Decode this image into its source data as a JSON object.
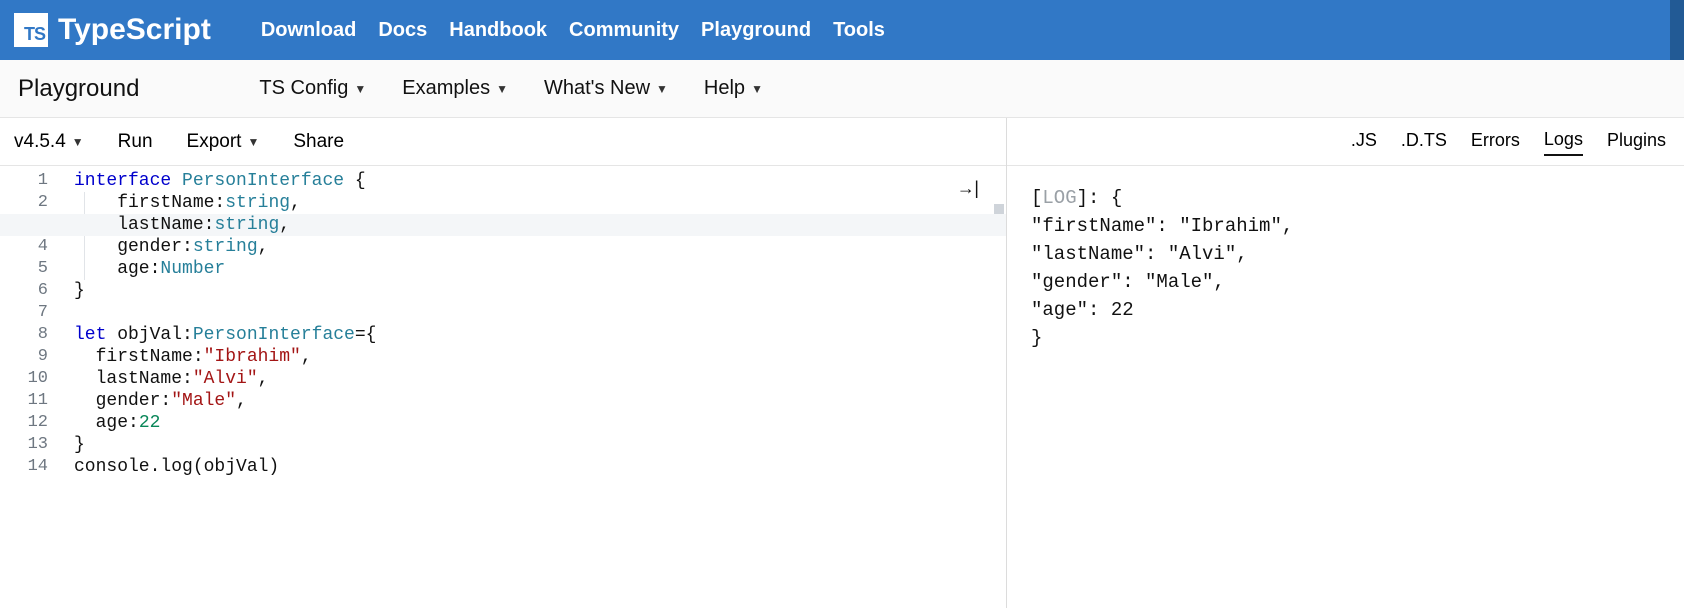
{
  "brand": {
    "logo": "TS",
    "name": "TypeScript"
  },
  "topnav": [
    "Download",
    "Docs",
    "Handbook",
    "Community",
    "Playground",
    "Tools"
  ],
  "subnav": {
    "title": "Playground",
    "items": [
      "TS Config",
      "Examples",
      "What's New",
      "Help"
    ]
  },
  "toolbar": {
    "version": "v4.5.4",
    "buttons": [
      "Run",
      "Export",
      "Share"
    ],
    "run_glyph": "→|",
    "right_tabs": [
      ".JS",
      ".D.TS",
      "Errors",
      "Logs",
      "Plugins"
    ],
    "active_right_tab": "Logs"
  },
  "editor": {
    "highlight_line": 3,
    "lines": [
      [
        [
          "kw",
          "interface"
        ],
        [
          "pln",
          " "
        ],
        [
          "id",
          "PersonInterface"
        ],
        [
          "pln",
          " {"
        ]
      ],
      [
        [
          "pln",
          "    firstName:"
        ],
        [
          "type",
          "string"
        ],
        [
          "pln",
          ","
        ]
      ],
      [
        [
          "pln",
          "    lastName:"
        ],
        [
          "type",
          "string"
        ],
        [
          "pln",
          ","
        ]
      ],
      [
        [
          "pln",
          "    gender:"
        ],
        [
          "type",
          "string"
        ],
        [
          "pln",
          ","
        ]
      ],
      [
        [
          "pln",
          "    age:"
        ],
        [
          "type",
          "Number"
        ]
      ],
      [
        [
          "pln",
          "}"
        ]
      ],
      [
        [
          "pln",
          ""
        ]
      ],
      [
        [
          "kw",
          "let"
        ],
        [
          "pln",
          " objVal:"
        ],
        [
          "id",
          "PersonInterface"
        ],
        [
          "pln",
          "={"
        ]
      ],
      [
        [
          "pln",
          "  firstName:"
        ],
        [
          "str",
          "\"Ibrahim\""
        ],
        [
          "pln",
          ","
        ]
      ],
      [
        [
          "pln",
          "  lastName:"
        ],
        [
          "str",
          "\"Alvi\""
        ],
        [
          "pln",
          ","
        ]
      ],
      [
        [
          "pln",
          "  gender:"
        ],
        [
          "str",
          "\"Male\""
        ],
        [
          "pln",
          ","
        ]
      ],
      [
        [
          "pln",
          "  age:"
        ],
        [
          "num",
          "22"
        ]
      ],
      [
        [
          "pln",
          "}"
        ]
      ],
      [
        [
          "pln",
          "console.log(objVal)"
        ]
      ]
    ]
  },
  "output": {
    "tag": "LOG",
    "lines": [
      "[LOG]: {",
      "  \"firstName\": \"Ibrahim\",",
      "  \"lastName\": \"Alvi\",",
      "  \"gender\": \"Male\",",
      "  \"age\": 22",
      "}"
    ]
  }
}
